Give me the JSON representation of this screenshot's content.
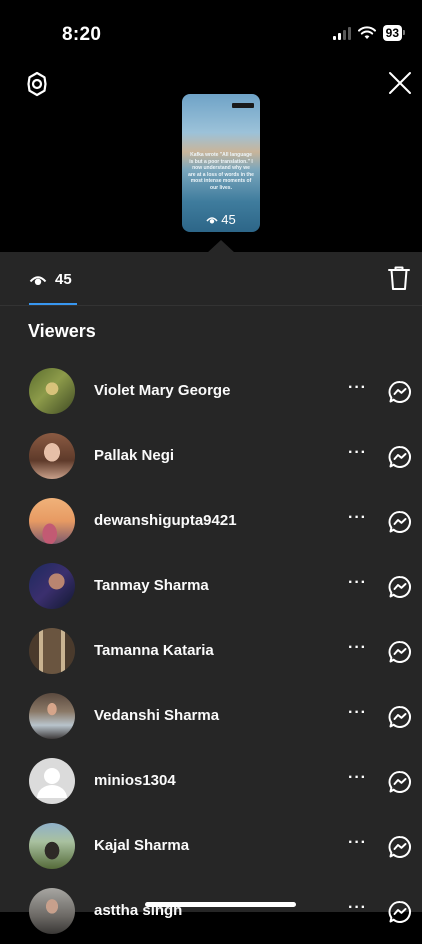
{
  "status_bar": {
    "time": "8:20",
    "battery": "93"
  },
  "story": {
    "caption": "Kafka wrote \"All language is but a poor translation.\" I now understand why we are at a loss of words in the most intense moments of our lives.",
    "view_count": "45"
  },
  "sheet": {
    "views_count": "45",
    "viewers_title": "Viewers"
  },
  "viewers": [
    {
      "name": "Violet Mary George"
    },
    {
      "name": "Pallak Negi"
    },
    {
      "name": "dewanshigupta9421"
    },
    {
      "name": "Tanmay Sharma"
    },
    {
      "name": "Tamanna Kataria"
    },
    {
      "name": "Vedanshi Sharma"
    },
    {
      "name": "minios1304"
    },
    {
      "name": "Kajal Sharma"
    },
    {
      "name": "asttha singh"
    }
  ],
  "icons": {
    "settings": "settings-icon",
    "close": "close-icon",
    "eye": "eye-icon",
    "trash": "trash-icon",
    "more": "more-icon",
    "message": "messenger-icon"
  },
  "colors": {
    "sheet_background": "#262626",
    "accent": "#3897f0"
  }
}
